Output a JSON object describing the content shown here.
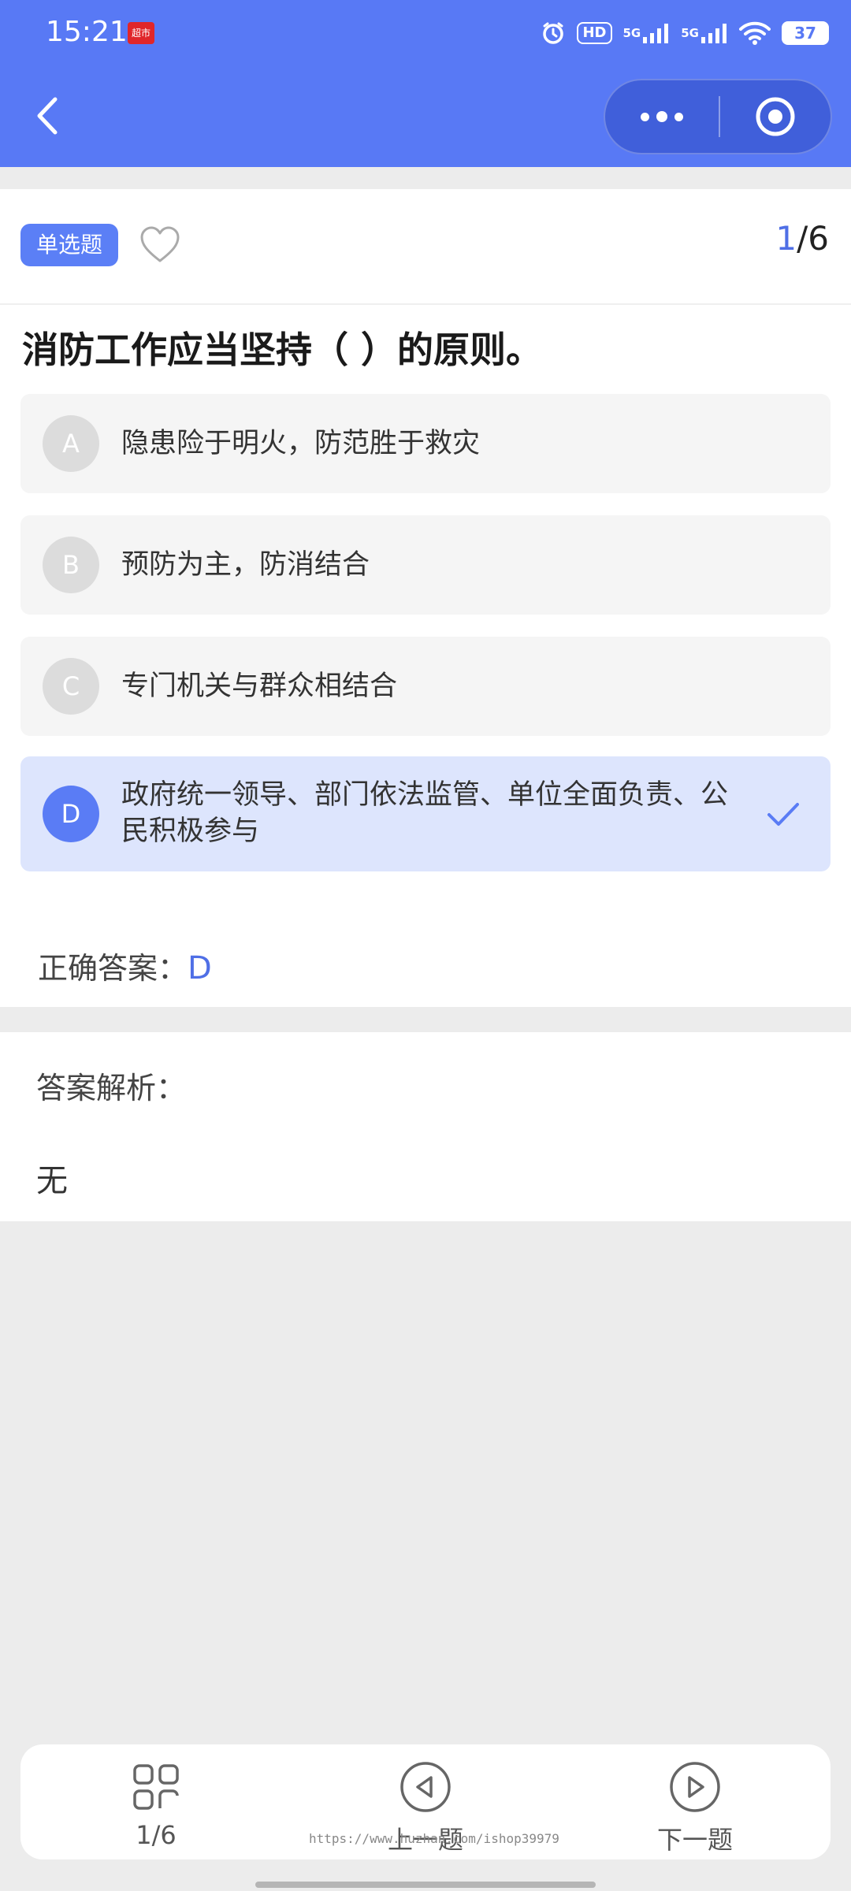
{
  "status_bar": {
    "time": "15:21",
    "app_badge": "超市",
    "hd": "HD",
    "signal1": "5G",
    "signal2": "5G",
    "battery": "37"
  },
  "header": {
    "back_icon": "chevron-left-icon",
    "more_icon": "more-dots-icon",
    "close_icon": "target-circle-icon"
  },
  "question": {
    "type_label": "单选题",
    "current": "1",
    "total": "/6",
    "text": "消防工作应当坚持（ ）的原则。",
    "options": [
      {
        "letter": "A",
        "text": "隐患险于明火，防范胜于救灾",
        "selected": false
      },
      {
        "letter": "B",
        "text": "预防为主，防消结合",
        "selected": false
      },
      {
        "letter": "C",
        "text": "专门机关与群众相结合",
        "selected": false
      },
      {
        "letter": "D",
        "text": "政府统一领导、部门依法监管、单位全面负责、公民积极参与",
        "selected": true
      }
    ],
    "answer_label": "正确答案：",
    "answer_value": "D"
  },
  "analysis": {
    "title": "答案解析：",
    "body": "无"
  },
  "bottom_nav": {
    "progress_label": "1/6",
    "prev_label": "上一题",
    "next_label": "下一题"
  },
  "watermark": "https://www.huzhan.com/ishop39979",
  "colors": {
    "brand": "#5879f5",
    "accent": "#4f6fe6",
    "selected_bg": "#dde5fd"
  }
}
